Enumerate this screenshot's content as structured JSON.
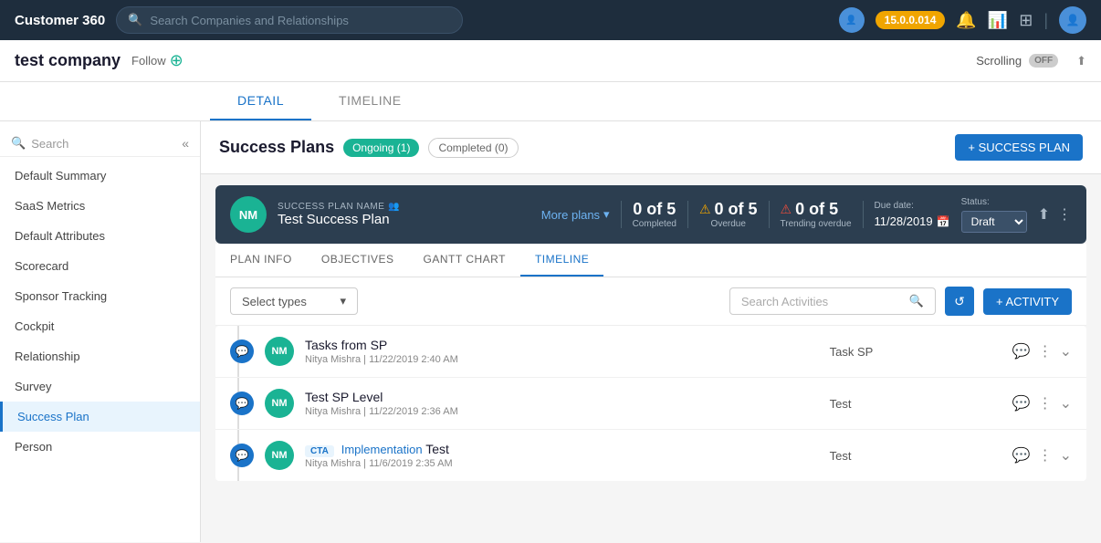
{
  "app": {
    "title": "Customer 360",
    "search_placeholder": "Search Companies and Relationships",
    "version": "15.0.0.014"
  },
  "sub_header": {
    "company_name": "test company",
    "follow_label": "Follow",
    "scrolling_label": "Scrolling",
    "toggle_state": "OFF"
  },
  "tabs": {
    "detail_label": "DETAIL",
    "timeline_label": "TIMELINE"
  },
  "sidebar": {
    "search_placeholder": "Search",
    "items": [
      {
        "label": "Default Summary",
        "active": false
      },
      {
        "label": "SaaS Metrics",
        "active": false
      },
      {
        "label": "Default Attributes",
        "active": false
      },
      {
        "label": "Scorecard",
        "active": false
      },
      {
        "label": "Sponsor Tracking",
        "active": false
      },
      {
        "label": "Cockpit",
        "active": false
      },
      {
        "label": "Relationship",
        "active": false
      },
      {
        "label": "Survey",
        "active": false
      },
      {
        "label": "Success Plan",
        "active": true
      },
      {
        "label": "Person",
        "active": false
      }
    ]
  },
  "success_plans": {
    "title": "Success Plans",
    "ongoing_label": "Ongoing (1)",
    "completed_label": "Completed (0)",
    "add_button": "+ SUCCESS PLAN",
    "plan": {
      "avatar_initials": "NM",
      "plan_name_label": "SUCCESS PLAN NAME",
      "plan_name": "Test Success Plan",
      "more_plans_label": "More plans",
      "completed_count": "0 of 5",
      "completed_label": "Completed",
      "overdue_count": "0 of 5",
      "overdue_label": "Overdue",
      "trending_count": "0 of 5",
      "trending_label": "Trending overdue",
      "due_date_label": "Due date:",
      "due_date": "11/28/2019",
      "status_label": "Status:",
      "status_value": "Draft"
    }
  },
  "plan_tabs": {
    "plan_info": "PLAN INFO",
    "objectives": "OBJECTIVES",
    "gantt_chart": "GANTT CHART",
    "timeline": "TIMELINE"
  },
  "timeline": {
    "select_types_placeholder": "Select types",
    "search_activities_placeholder": "Search Activities",
    "add_activity_button": "+ ACTIVITY",
    "activities": [
      {
        "avatar": "NM",
        "title": "Tasks from SP",
        "meta": "Nitya Mishra  |  11/22/2019 2:40 AM",
        "type": "Task SP",
        "cta_badge": "",
        "cta_label": ""
      },
      {
        "avatar": "NM",
        "title": "Test SP Level",
        "meta": "Nitya Mishra  |  11/22/2019 2:36 AM",
        "type": "Test",
        "cta_badge": "",
        "cta_label": ""
      },
      {
        "avatar": "NM",
        "title": "Test",
        "meta": "Nitya Mishra  |  11/6/2019 2:35 AM",
        "type": "Test",
        "cta_badge": "CTA",
        "cta_label": "Implementation"
      }
    ]
  },
  "icons": {
    "search": "🔍",
    "bell": "🔔",
    "chart": "📊",
    "user": "👤",
    "share": "⬆",
    "calendar": "📅",
    "refresh": "↺",
    "chevron_down": "▾",
    "dots": "⋮",
    "comment": "💬",
    "chevron_expand": "⌄",
    "users": "👥",
    "collapse": "«",
    "plus": "+"
  }
}
